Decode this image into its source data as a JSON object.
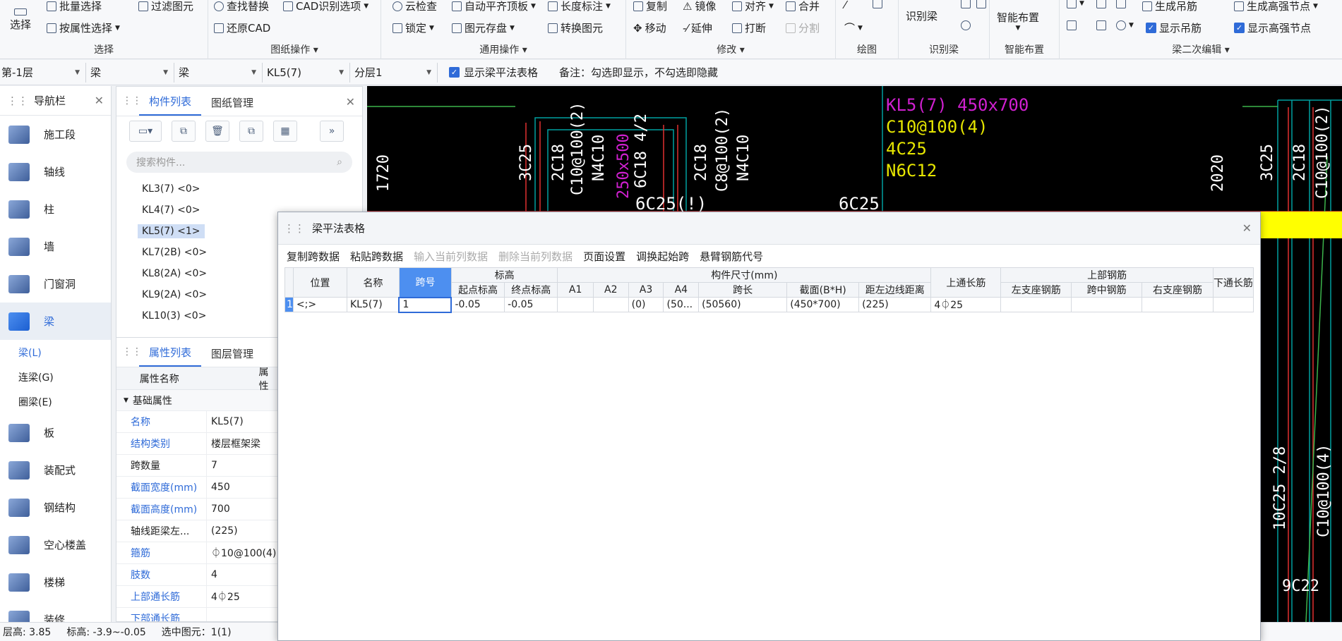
{
  "ribbon": {
    "select": {
      "big": "选择",
      "batch": "批量选择",
      "filter": "过滤图元",
      "by_attr": "按属性选择",
      "label": "选择"
    },
    "drawing_ops": {
      "find_replace": "查找替换",
      "cad_options": "CAD识别选项",
      "restore_cad": "还原CAD",
      "label": "图纸操作"
    },
    "common_ops": {
      "cloud_check": "云检查",
      "auto_flat": "自动平齐顶板",
      "length_mark": "长度标注",
      "lock": "锁定",
      "save_elem": "图元存盘",
      "convert_elem": "转换图元",
      "label": "通用操作"
    },
    "modify": {
      "copy": "复制",
      "mirror": "镜像",
      "align": "对齐",
      "merge": "合并",
      "move": "移动",
      "extend": "延伸",
      "break": "打断",
      "split": "分割",
      "label": "修改"
    },
    "draw": {
      "label": "绘图"
    },
    "recognize": {
      "btn": "识别梁",
      "label": "识别梁"
    },
    "smart": {
      "btn": "智能布置",
      "label": "智能布置"
    },
    "secondary": {
      "gen_hanger": "生成吊筋",
      "gen_haunch": "生成高强节点",
      "show_hanger": "显示吊筋",
      "show_haunch": "显示高强节点",
      "label": "梁二次编辑"
    }
  },
  "filterbar": {
    "floor": "第-1层",
    "type1": "梁",
    "type2": "梁",
    "component": "KL5(7)",
    "layer": "分层1",
    "show_table_label": "显示梁平法表格",
    "note": "备注：勾选即显示，不勾选即隐藏"
  },
  "nav": {
    "title": "导航栏",
    "items": [
      {
        "label": "施工段",
        "icon": "construction-stage-icon"
      },
      {
        "label": "轴线",
        "icon": "axis-grid-icon"
      },
      {
        "label": "柱",
        "icon": "column-icon"
      },
      {
        "label": "墙",
        "icon": "wall-icon"
      },
      {
        "label": "门窗洞",
        "icon": "door-window-icon"
      },
      {
        "label": "梁",
        "icon": "beam-icon"
      }
    ],
    "sub_items": [
      "梁(L)",
      "连梁(G)",
      "圈梁(E)"
    ],
    "items2": [
      {
        "label": "板",
        "icon": "slab-icon"
      },
      {
        "label": "装配式",
        "icon": "prefab-icon"
      },
      {
        "label": "钢结构",
        "icon": "steel-icon"
      },
      {
        "label": "空心楼盖",
        "icon": "hollow-floor-icon"
      },
      {
        "label": "楼梯",
        "icon": "stairs-icon"
      },
      {
        "label": "装修",
        "icon": "decoration-icon"
      }
    ]
  },
  "component_panel": {
    "tab1": "构件列表",
    "tab2": "图纸管理",
    "search_placeholder": "搜索构件...",
    "items": [
      "KL3(7) <0>",
      "KL4(7) <0>",
      "KL5(7) <1>",
      "KL7(2B) <0>",
      "KL8(2A) <0>",
      "KL9(2A) <0>",
      "KL10(3) <0>"
    ]
  },
  "property_panel": {
    "tab1": "属性列表",
    "tab2": "图层管理",
    "header_name": "属性名称",
    "header_value": "属性",
    "group": "基础属性",
    "rows": [
      {
        "name": "名称",
        "value": "KL5(7)"
      },
      {
        "name": "结构类别",
        "value": "楼层框架梁"
      },
      {
        "name": "跨数量",
        "value": "7"
      },
      {
        "name": "截面宽度(mm)",
        "value": "450"
      },
      {
        "name": "截面高度(mm)",
        "value": "700"
      },
      {
        "name": "轴线距梁左...",
        "value": "(225)"
      },
      {
        "name": "箍筋",
        "value": "⏀10@100(4)"
      },
      {
        "name": "肢数",
        "value": "4"
      },
      {
        "name": "上部通长筋",
        "value": "4⏀25"
      },
      {
        "name": "下部通长筋",
        "value": ""
      }
    ]
  },
  "cad_text": {
    "t1": "KL5(7) 450x700",
    "t2": "C10@100(4)",
    "t3": "4C25",
    "t4": "N6C12",
    "t5": "1720",
    "t6": "3C25",
    "t7": "2C18",
    "t8": "C10@100(2)",
    "t9": "N4C10",
    "t10": "250x500",
    "t11": "6C18 4/2",
    "t12": "2C18",
    "t13": "C8@100(2)",
    "t14": "N4C10",
    "t15": "6C25(!)",
    "t16": "6C25",
    "t17": "2020",
    "t18": "3C25",
    "t19": "2C18",
    "t20": "C10@100(2)",
    "t21": "10C25 2/8",
    "t22": "C10@100(4)",
    "t23": "9C22"
  },
  "status": {
    "floor_height_label": "层高:",
    "floor_height": "3.85",
    "elev_label": "标高:",
    "elev": "-3.9~-0.05",
    "selected": "选中图元：1(1)"
  },
  "dialog": {
    "title": "梁平法表格",
    "toolbar": [
      "复制跨数据",
      "粘贴跨数据",
      "输入当前列数据",
      "删除当前列数据",
      "页面设置",
      "调换起始跨",
      "悬臂钢筋代号"
    ],
    "headers": {
      "pos": "位置",
      "name": "名称",
      "span": "跨号",
      "elev": "标高",
      "elev_start": "起点标高",
      "elev_end": "终点标高",
      "size": "构件尺寸(mm)",
      "a1": "A1",
      "a2": "A2",
      "a3": "A3",
      "a4": "A4",
      "span_len": "跨长",
      "section": "截面(B*H)",
      "edge_dist": "距左边线距离",
      "top_cont": "上通长筋",
      "top_rebar": "上部钢筋",
      "left_seat": "左支座钢筋",
      "mid_span": "跨中钢筋",
      "right_seat": "右支座钢筋",
      "bottom_cont": "下通长筋"
    },
    "row": {
      "num": "1",
      "pos": "<;>",
      "name": "KL5(7)",
      "span": "1",
      "elev_start": "-0.05",
      "elev_end": "-0.05",
      "a1": "",
      "a2": "",
      "a3": "(0)",
      "a4": "(50...",
      "span_len": "(50560)",
      "section": "(450*700)",
      "edge_dist": "(225)",
      "top_cont": "4⏀25"
    }
  }
}
